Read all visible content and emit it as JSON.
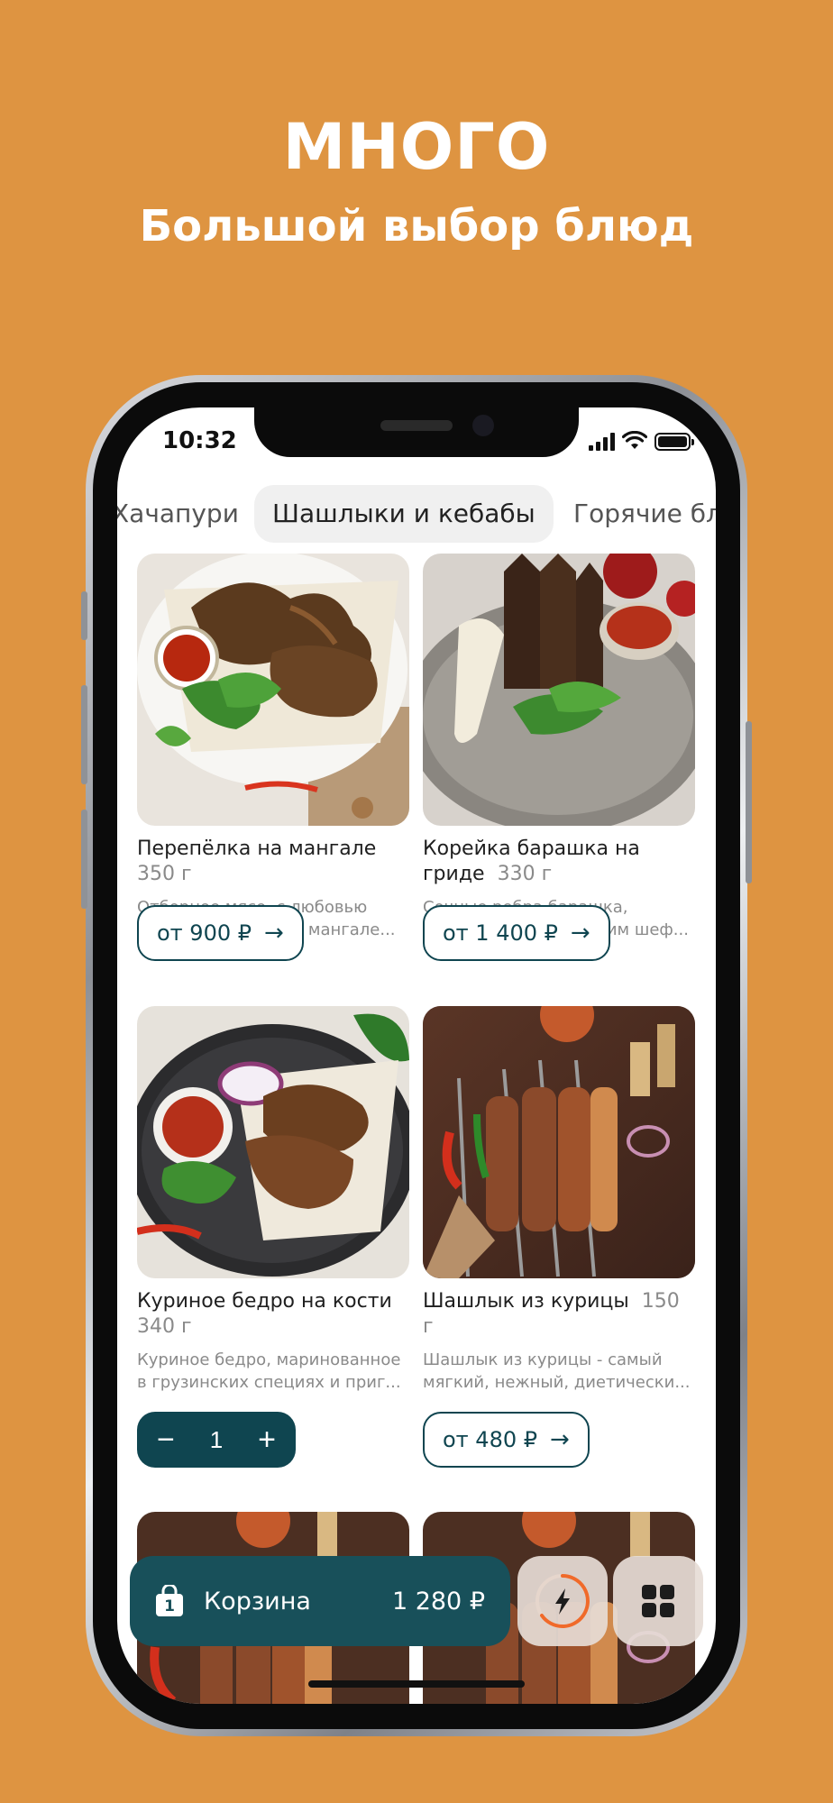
{
  "promo": {
    "title": "МНОГО",
    "subtitle": "Большой выбор блюд"
  },
  "status_bar": {
    "time": "10:32"
  },
  "tabs": [
    {
      "label": "Хачапури",
      "active": false
    },
    {
      "label": "Шашлыки и кебабы",
      "active": true
    },
    {
      "label": "Горячие бл",
      "active": false
    }
  ],
  "products": [
    {
      "name": "Перепёлка на мангале",
      "weight": "350 г",
      "description_line1": "Отборное мясо, с любовью",
      "description_line2": "приготовленное на мангале...",
      "price": "от 900 ₽"
    },
    {
      "name": "Корейка барашка на",
      "name_line2": "гриде",
      "weight": "330 г",
      "description_line1": "Сочные ребра барашка,",
      "description_line2": "приготовленные нашим шеф...",
      "price": "от 1 400 ₽"
    },
    {
      "name": "Куриное бедро на кости",
      "weight": "340 г",
      "description_line1": "Куриное бедро, маринованное",
      "description_line2": "в грузинских специях и приг...",
      "quantity": "1"
    },
    {
      "name": "Шашлык из курицы",
      "weight": "150 г",
      "description_line1": "Шашлык из курицы - самый",
      "description_line2": "мягкий, нежный, диетически...",
      "price": "от 480 ₽"
    }
  ],
  "cart": {
    "label": "Корзина",
    "badge": "1",
    "total": "1 280 ₽"
  },
  "icons": {
    "cart": "shopping-bag-icon",
    "quick": "lightning-icon",
    "menu": "grid-icon"
  },
  "colors": {
    "background": "#DE9441",
    "primary": "#0F4550",
    "cart_bar": "#18505A",
    "accent": "#F06A2A"
  }
}
